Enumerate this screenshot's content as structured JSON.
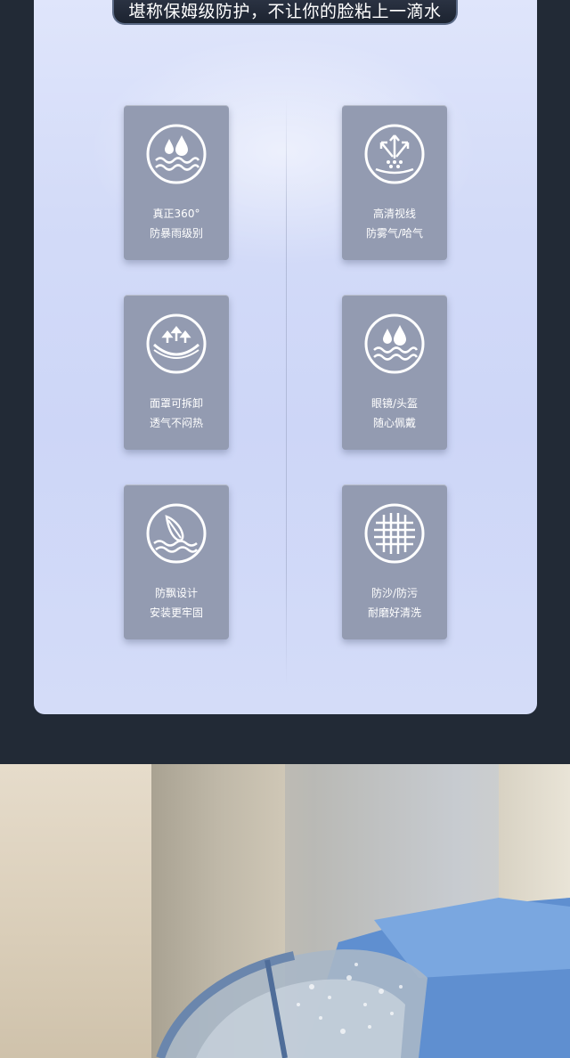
{
  "banner": {
    "text": "堪称保姆级防护，不让你的脸粘上一滴水"
  },
  "features": [
    {
      "icon": "rain-waves-icon",
      "line1": "真正360°",
      "line2": "防暴雨级别"
    },
    {
      "icon": "clear-vision-arrows-icon",
      "line1": "高清视线",
      "line2": "防雾气/哈气"
    },
    {
      "icon": "breathable-arrows-icon",
      "line1": "面罩可拆卸",
      "line2": "透气不闷热"
    },
    {
      "icon": "water-drops-icon",
      "line1": "眼镜/头盔",
      "line2": "随心佩戴"
    },
    {
      "icon": "feather-wind-icon",
      "line1": "防飘设计",
      "line2": "安装更牢固"
    },
    {
      "icon": "mesh-grid-icon",
      "line1": "防沙/防污",
      "line2": "耐磨好清洗"
    }
  ],
  "colors": {
    "background": "#222a36",
    "panel": "#d3dbf8",
    "card": "#939bb1",
    "card_text": "#ffffff",
    "banner_border": "#5b6a86"
  }
}
